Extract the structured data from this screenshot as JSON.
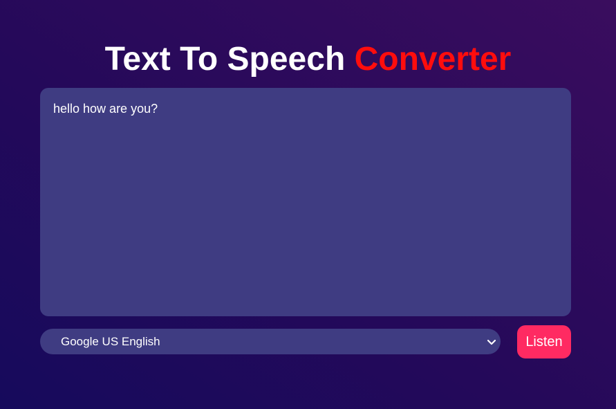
{
  "header": {
    "title_main": "Text To Speech",
    "title_accent": "Converter"
  },
  "editor": {
    "text": "hello how are you?"
  },
  "voice_select": {
    "selected": "Google US English",
    "icon": "chevron-down-icon"
  },
  "actions": {
    "listen_label": "Listen"
  },
  "colors": {
    "accent_title": "#ff0d0d",
    "panel": "#3f3c82",
    "button": "#ff2a62"
  }
}
